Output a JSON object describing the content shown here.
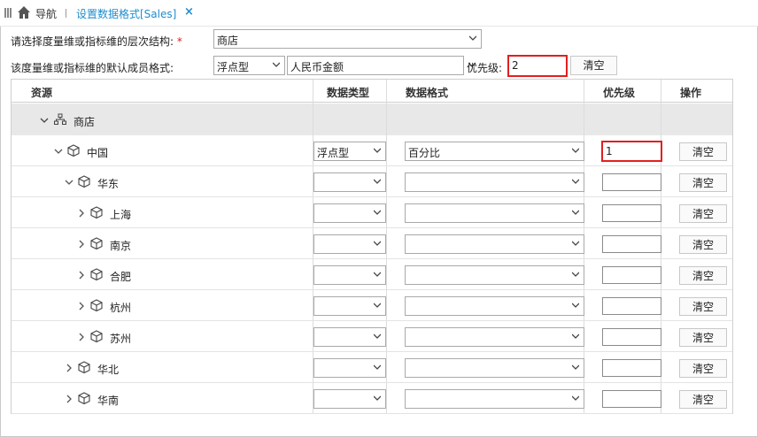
{
  "tabs": {
    "nav_label": "导航",
    "active_tab": "设置数据格式[Sales]",
    "close_glyph": "×"
  },
  "form": {
    "hierarchy_label": "请选择度量维或指标维的层次结构:",
    "required_mark": "*",
    "hierarchy_value": "商店",
    "default_format_label": "该度量维或指标维的默认成员格式:",
    "default_type_value": "浮点型",
    "default_format_value": "人民币金额",
    "priority_label": "优先级:",
    "priority_value": "2",
    "clear_label": "清空"
  },
  "table": {
    "headers": [
      "资源",
      "数据类型",
      "数据格式",
      "优先级",
      "操作"
    ],
    "group": "商店",
    "rows": [
      {
        "name": "中国",
        "type": "浮点型",
        "format": "百分比",
        "priority": "1",
        "action": "清空",
        "expanded": true
      },
      {
        "name": "华东",
        "type": "",
        "format": "",
        "priority": "",
        "action": "清空",
        "expanded": true
      },
      {
        "name": "上海",
        "type": "",
        "format": "",
        "priority": "",
        "action": "清空",
        "expanded": false
      },
      {
        "name": "南京",
        "type": "",
        "format": "",
        "priority": "",
        "action": "清空",
        "expanded": false
      },
      {
        "name": "合肥",
        "type": "",
        "format": "",
        "priority": "",
        "action": "清空",
        "expanded": false
      },
      {
        "name": "杭州",
        "type": "",
        "format": "",
        "priority": "",
        "action": "清空",
        "expanded": false
      },
      {
        "name": "苏州",
        "type": "",
        "format": "",
        "priority": "",
        "action": "清空",
        "expanded": false
      },
      {
        "name": "华北",
        "type": "",
        "format": "",
        "priority": "",
        "action": "清空",
        "expanded": false
      },
      {
        "name": "华南",
        "type": "",
        "format": "",
        "priority": "",
        "action": "清空",
        "expanded": false
      }
    ]
  },
  "colors": {
    "accent": "#1e8dcf",
    "highlight_border": "#e02020",
    "group_row_bg": "#e8e8e8"
  },
  "icons": [
    "grip-icon",
    "home-icon",
    "close-icon",
    "hierarchy-icon",
    "cube-icon",
    "chevron-down-icon",
    "chevron-right-icon"
  ]
}
